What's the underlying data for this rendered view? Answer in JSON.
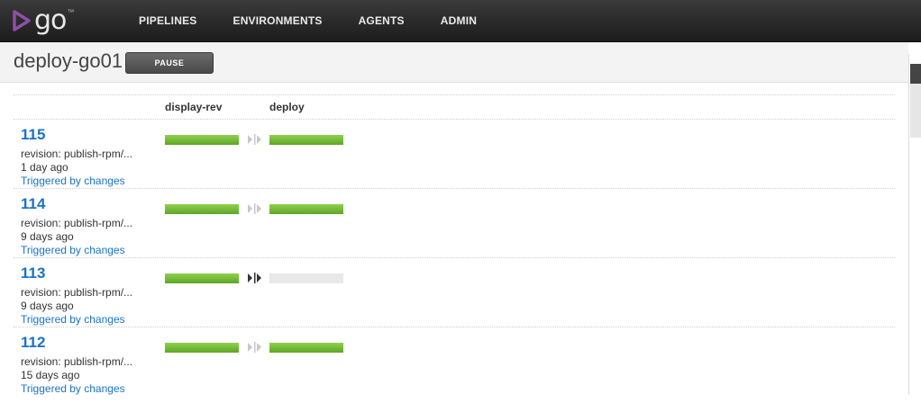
{
  "brand": {
    "logo_text": "go",
    "tm": "™"
  },
  "nav": {
    "items": [
      "PIPELINES",
      "ENVIRONMENTS",
      "AGENTS",
      "ADMIN"
    ]
  },
  "header": {
    "title": "deploy-go01",
    "pause_label": "PAUSE"
  },
  "stages": {
    "col1": "display-rev",
    "col2": "deploy"
  },
  "runs": [
    {
      "label": "115",
      "revision": "revision: publish-rpm/...",
      "age": "1 day ago",
      "trigger": "Triggered by changes",
      "stage1": "passed",
      "stage2": "passed",
      "arrow": "light"
    },
    {
      "label": "114",
      "revision": "revision: publish-rpm/...",
      "age": "9 days ago",
      "trigger": "Triggered by changes",
      "stage1": "passed",
      "stage2": "passed",
      "arrow": "light"
    },
    {
      "label": "113",
      "revision": "revision: publish-rpm/...",
      "age": "9 days ago",
      "trigger": "Triggered by changes",
      "stage1": "passed",
      "stage2": "not-run",
      "arrow": "dark"
    },
    {
      "label": "112",
      "revision": "revision: publish-rpm/...",
      "age": "15 days ago",
      "trigger": "Triggered by changes",
      "stage1": "passed",
      "stage2": "passed",
      "arrow": "light"
    }
  ],
  "colors": {
    "link": "#1a73c8",
    "passed": "#6db33f",
    "nav_bg": "#2a2a2a",
    "logo": "#8e4fa8"
  }
}
